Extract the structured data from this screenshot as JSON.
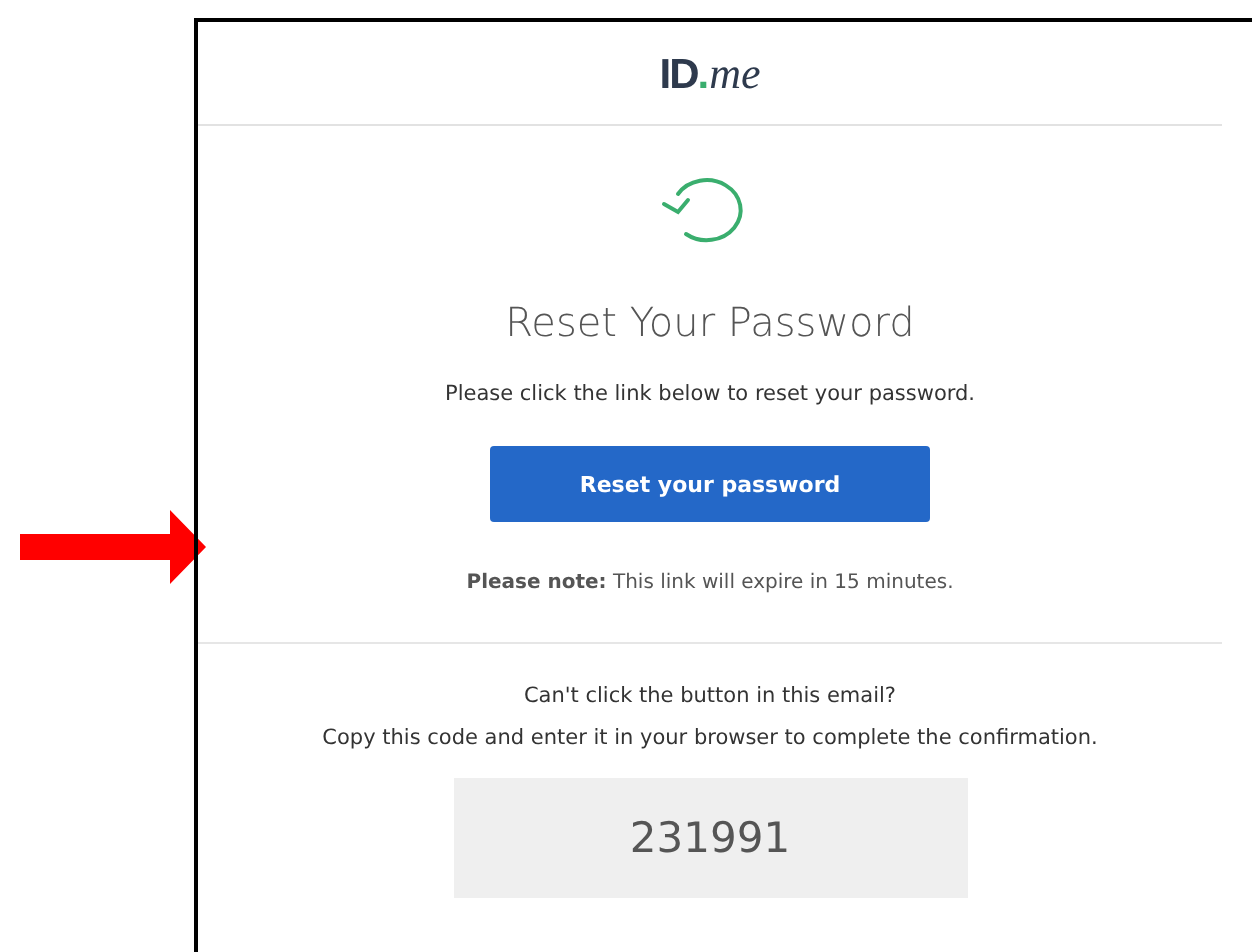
{
  "logo": {
    "main": "ID",
    "dot": ".",
    "suffix": "me"
  },
  "title": "Reset Your Password",
  "instruction": "Please click the link below to reset your password.",
  "reset_button": "Reset your password",
  "note": "**Please note:** This link will expire in 15 minutes.",
  "fallback_question": "Can't click the button in this email?",
  "fallback_instruction": "Copy this code and enter it in your browser to complete the confirmation.",
  "code": "231991"
}
